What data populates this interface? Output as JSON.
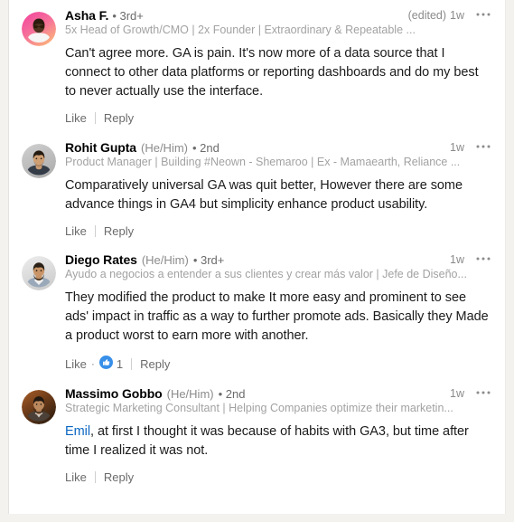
{
  "panel": {
    "background": "#ffffff",
    "page_background": "#f3f2ef",
    "link_color": "#0a66c2"
  },
  "comments": [
    {
      "id": "asha-f",
      "author": "Asha F.",
      "pronouns": "",
      "degree": "• 3rd+",
      "headline": "5x Head of Growth/CMO | 2x Founder | Extraordinary & Repeatable ...",
      "edited": "(edited)",
      "timestamp": "1w",
      "text": "Can't agree more. GA is pain. It's now more of a data source that I connect to other data platforms or reporting dashboards and do my best to never actually use the interface.",
      "mention": "",
      "like_label": "Like",
      "reply_label": "Reply",
      "reaction_count": "",
      "avatar": {
        "name": "avatar-asha-f",
        "bg_start": "#f04aa0",
        "bg_end": "#f8a06a",
        "skin": "#5a3a22",
        "shirt": "#f2f2f2"
      }
    },
    {
      "id": "rohit-gupta",
      "author": "Rohit Gupta",
      "pronouns": "(He/Him)",
      "degree": "• 2nd",
      "headline": "Product Manager | Building #Neown - Shemaroo | Ex - Mamaearth, Reliance ...",
      "edited": "",
      "timestamp": "1w",
      "text": "Comparatively universal GA was quit better, However there are some advance things in GA4 but simplicity enhance product usability.",
      "mention": "",
      "like_label": "Like",
      "reply_label": "Reply",
      "reaction_count": "",
      "avatar": {
        "name": "avatar-rohit-gupta",
        "bg_start": "#c9c9c9",
        "bg_end": "#b4b4b4",
        "skin": "#c99a70",
        "shirt": "#3d4450"
      }
    },
    {
      "id": "diego-rates",
      "author": "Diego Rates",
      "pronouns": "(He/Him)",
      "degree": "• 3rd+",
      "headline": "Ayudo a negocios a entender a sus clientes y crear más valor | Jefe de Diseño...",
      "edited": "",
      "timestamp": "1w",
      "text": "They modified the product to make It more easy and prominent to see ads' impact in traffic as a way to further promote ads. Basically they Made a product worst to earn more with another.",
      "mention": "",
      "like_label": "Like",
      "reply_label": "Reply",
      "reaction_count": "1",
      "reaction_icon": "like-thumb-icon",
      "avatar": {
        "name": "avatar-diego-rates",
        "bg_start": "#e7e7e7",
        "bg_end": "#d2d2d2",
        "skin": "#c08f63",
        "shirt": "#93a3b5"
      }
    },
    {
      "id": "massimo-gobbo",
      "author": "Massimo Gobbo",
      "pronouns": "(He/Him)",
      "degree": "• 2nd",
      "headline": "Strategic Marketing Consultant | Helping Companies optimize their marketin...",
      "edited": "",
      "timestamp": "1w",
      "text": ", at first I thought it was because of habits with GA3, but time after time I realized it was not.",
      "mention": "Emil",
      "like_label": "Like",
      "reply_label": "Reply",
      "reaction_count": "",
      "avatar": {
        "name": "avatar-massimo-gobbo",
        "bg_start": "#8a4a22",
        "bg_end": "#3a2414",
        "skin": "#b98a60",
        "shirt": "#4a4038"
      }
    }
  ],
  "icons": {
    "more": "ellipsis-horizontal-icon",
    "like_reaction": "like-thumb-icon"
  }
}
